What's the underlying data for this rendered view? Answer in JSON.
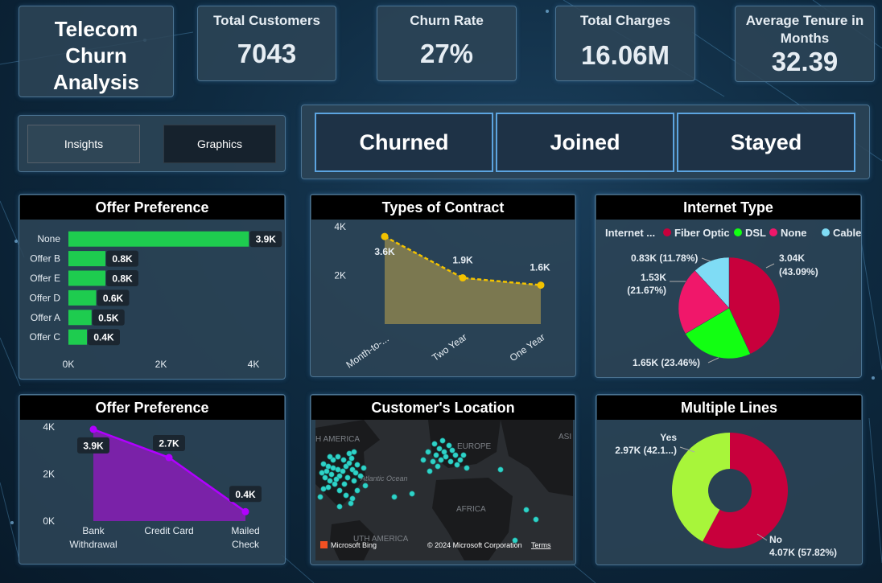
{
  "dashboard": {
    "title_lines": [
      "Telecom",
      "Churn",
      "Analysis"
    ]
  },
  "kpis": [
    {
      "label": "Total Customers",
      "value": "7043"
    },
    {
      "label": "Churn Rate",
      "value": "27%"
    },
    {
      "label": "Total Charges",
      "value": "16.06M"
    },
    {
      "label": "Average Tenure in Months",
      "value": "32.39"
    }
  ],
  "nav": {
    "insights_label": "Insights",
    "graphics_label": "Graphics"
  },
  "status_buttons": {
    "churned": "Churned",
    "joined": "Joined",
    "stayed": "Stayed"
  },
  "panels": {
    "offer_pref_bar_title": "Offer Preference",
    "contract_title": "Types of Contract",
    "internet_title": "Internet Type",
    "offer_pref_area_title": "Offer Preference",
    "location_title": "Customer's Location",
    "multiple_lines_title": "Multiple Lines"
  },
  "map": {
    "labels": [
      "H AMERICA",
      "EUROPE",
      "Atlantic Ocean",
      "AFRICA",
      "ASI",
      "UTH AMERICA"
    ],
    "attribution": "© 2024 Microsoft Corporation",
    "terms": "Terms",
    "bing": "Microsoft Bing"
  },
  "colors": {
    "green_bar": "#1ecc4f",
    "contract_fill": "#7f7b50",
    "contract_line": "#f2c200",
    "fiber": "#c8003c",
    "dsl": "#12ff12",
    "none": "#f0176a",
    "cable": "#7fdcf5",
    "purple": "#7a22a8",
    "purple_line": "#b100ff",
    "yes": "#a8f53a",
    "no": "#c8003c"
  },
  "chart_data": [
    {
      "type": "bar",
      "title": "Offer Preference",
      "orientation": "horizontal",
      "categories": [
        "None",
        "Offer B",
        "Offer E",
        "Offer D",
        "Offer A",
        "Offer C"
      ],
      "values": [
        3.9,
        0.8,
        0.8,
        0.6,
        0.5,
        0.4
      ],
      "data_labels": [
        "3.9K",
        "0.8K",
        "0.8K",
        "0.6K",
        "0.5K",
        "0.4K"
      ],
      "x_ticks": [
        "0K",
        "2K",
        "4K"
      ],
      "xlim": [
        0,
        4
      ]
    },
    {
      "type": "area",
      "title": "Types of Contract",
      "categories": [
        "Month-to-...",
        "Two Year",
        "One Year"
      ],
      "values": [
        3.6,
        1.9,
        1.6
      ],
      "data_labels": [
        "3.6K",
        "1.9K",
        "1.6K"
      ],
      "y_ticks": [
        "4K",
        "2K"
      ],
      "ylim": [
        0,
        4
      ]
    },
    {
      "type": "pie",
      "title": "Internet Type",
      "legend_title": "Internet ...",
      "legend_position": "top",
      "series": [
        {
          "name": "Fiber Optic",
          "value": 3.04,
          "label": "3.04K",
          "pct": "(43.09%)"
        },
        {
          "name": "DSL",
          "value": 1.65,
          "label": "1.65K (23.46%)"
        },
        {
          "name": "None",
          "value": 1.53,
          "label": "1.53K",
          "pct": "(21.67%)"
        },
        {
          "name": "Cable",
          "value": 0.83,
          "label": "0.83K (11.78%)"
        }
      ]
    },
    {
      "type": "area",
      "title": "Offer Preference",
      "categories": [
        "Bank Withdrawal",
        "Credit Card",
        "Mailed Check"
      ],
      "category_lines": [
        [
          "Bank",
          "Withdrawal"
        ],
        [
          "Credit Card"
        ],
        [
          "Mailed",
          "Check"
        ]
      ],
      "values": [
        3.9,
        2.7,
        0.4
      ],
      "data_labels": [
        "3.9K",
        "2.7K",
        "0.4K"
      ],
      "y_ticks": [
        "4K",
        "2K",
        "0K"
      ],
      "ylim": [
        0,
        4
      ]
    },
    {
      "type": "pie",
      "title": "Multiple Lines",
      "donut": true,
      "series": [
        {
          "name": "Yes",
          "value": 2.97,
          "label": "2.97K (42.1...)"
        },
        {
          "name": "No",
          "value": 4.07,
          "label": "4.07K (57.82%)"
        }
      ]
    }
  ]
}
